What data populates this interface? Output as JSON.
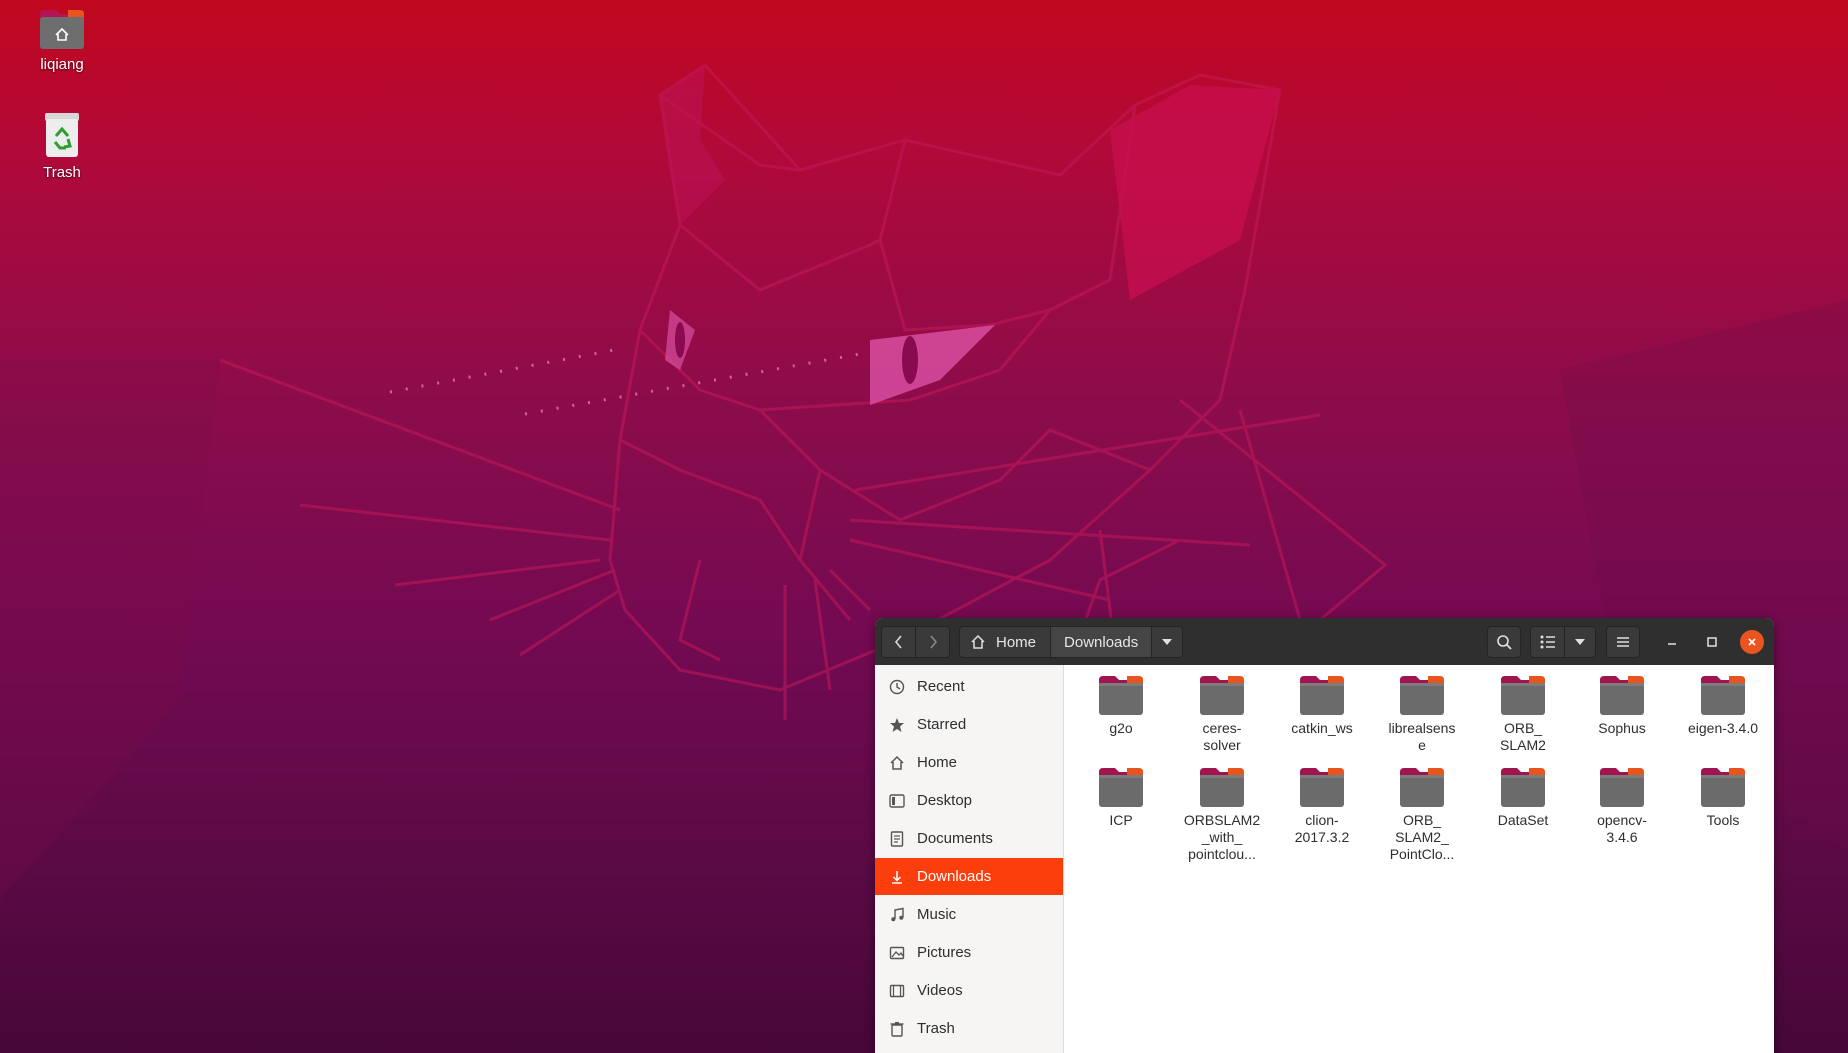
{
  "desktop": {
    "icons": [
      {
        "label": "liqiang",
        "icon": "home-folder-icon"
      },
      {
        "label": "Trash",
        "icon": "trash-icon"
      }
    ]
  },
  "window": {
    "nav": {
      "back_icon": "chevron-left-icon",
      "forward_icon": "chevron-right-icon"
    },
    "path": {
      "home": "Home",
      "current": "Downloads"
    },
    "controls": {
      "search_icon": "search-icon",
      "view_icon": "list-view-icon",
      "menu_icon": "hamburger-icon"
    },
    "sidebar": {
      "items": [
        {
          "label": "Recent",
          "icon": "clock-icon"
        },
        {
          "label": "Starred",
          "icon": "star-icon"
        },
        {
          "label": "Home",
          "icon": "home-icon"
        },
        {
          "label": "Desktop",
          "icon": "desktop-icon"
        },
        {
          "label": "Documents",
          "icon": "document-icon"
        },
        {
          "label": "Downloads",
          "icon": "download-icon",
          "active": true
        },
        {
          "label": "Music",
          "icon": "music-icon"
        },
        {
          "label": "Pictures",
          "icon": "picture-icon"
        },
        {
          "label": "Videos",
          "icon": "video-icon"
        },
        {
          "label": "Trash",
          "icon": "trash-icon"
        }
      ]
    },
    "files": [
      {
        "name": "g2o"
      },
      {
        "name": "ceres-\nsolver"
      },
      {
        "name": "catkin_ws"
      },
      {
        "name": "librealsens\ne"
      },
      {
        "name": "ORB_\nSLAM2"
      },
      {
        "name": "Sophus"
      },
      {
        "name": "eigen-3.4.0"
      },
      {
        "name": "ICP"
      },
      {
        "name": "ORBSLAM2\n_with_\npointclou..."
      },
      {
        "name": "clion-\n2017.3.2"
      },
      {
        "name": "ORB_\nSLAM2_\nPointClo..."
      },
      {
        "name": "DataSet"
      },
      {
        "name": "opencv-\n3.4.6"
      },
      {
        "name": "Tools"
      }
    ]
  },
  "colors": {
    "accent": "#fb3e0c",
    "close": "#e95420",
    "folder_body": "#6b6b6b",
    "folder_tab": "#a0154f"
  }
}
